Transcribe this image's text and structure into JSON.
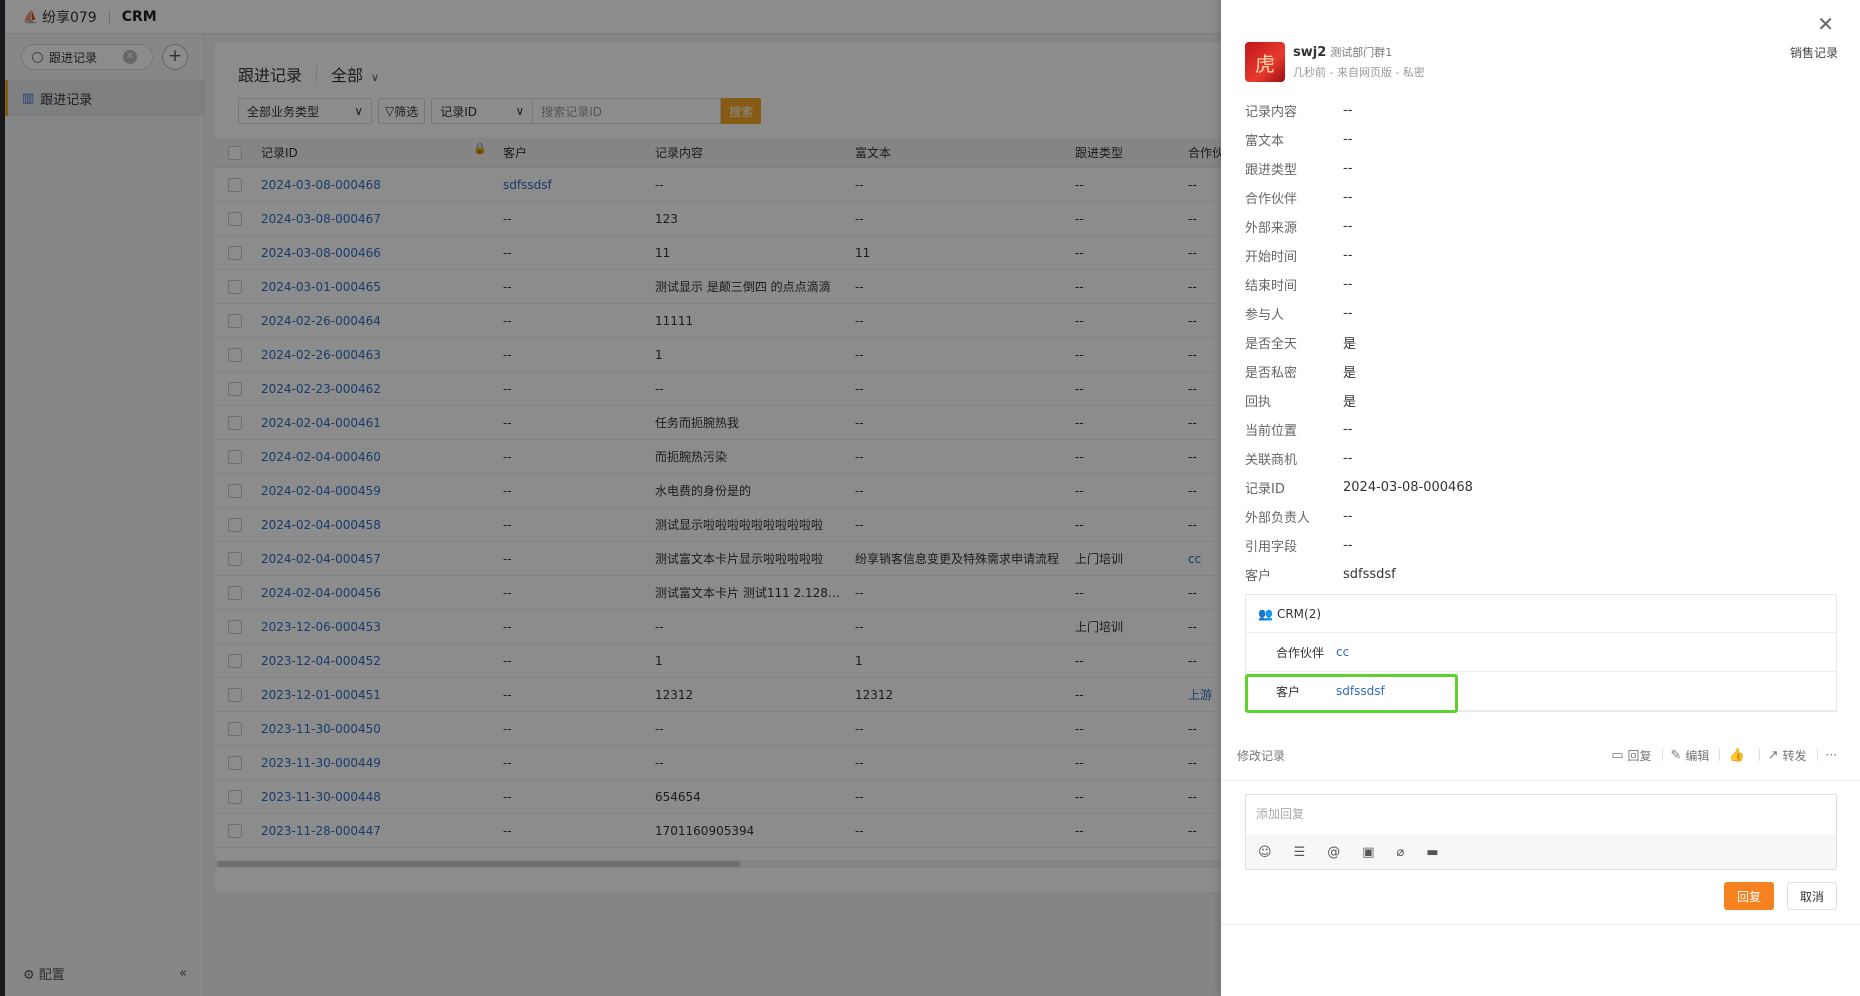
{
  "app": {
    "logo_text": "纷享079",
    "module": "CRM"
  },
  "sidebar": {
    "search_value": "跟进记录",
    "nav_item": "跟进记录",
    "footer_label": "配置",
    "collapse_glyph": "«"
  },
  "page": {
    "title": "跟进记录",
    "view": "全部",
    "business_type": "全部业务类型",
    "filter_label": "筛选",
    "search_field": "记录ID",
    "search_placeholder": "搜索记录ID",
    "search_button": "搜索"
  },
  "table": {
    "columns": [
      "记录ID",
      "客户",
      "记录内容",
      "富文本",
      "跟进类型",
      "合作伙"
    ],
    "rows": [
      {
        "id": "2024-03-08-000468",
        "customer": "sdfssdsf",
        "content": "--",
        "rich": "--",
        "type": "--",
        "partner": "--"
      },
      {
        "id": "2024-03-08-000467",
        "customer": "--",
        "content": "123",
        "rich": "--",
        "type": "--",
        "partner": "--"
      },
      {
        "id": "2024-03-08-000466",
        "customer": "--",
        "content": "11",
        "rich": "11",
        "type": "--",
        "partner": "--"
      },
      {
        "id": "2024-03-01-000465",
        "customer": "--",
        "content": "测试显示 是颠三倒四 的点点滴滴",
        "rich": "--",
        "type": "--",
        "partner": "--"
      },
      {
        "id": "2024-02-26-000464",
        "customer": "--",
        "content": "11111",
        "rich": "--",
        "type": "--",
        "partner": "--"
      },
      {
        "id": "2024-02-26-000463",
        "customer": "--",
        "content": "1",
        "rich": "--",
        "type": "--",
        "partner": "--"
      },
      {
        "id": "2024-02-23-000462",
        "customer": "--",
        "content": "--",
        "rich": "--",
        "type": "--",
        "partner": "--"
      },
      {
        "id": "2024-02-04-000461",
        "customer": "--",
        "content": "任务而扼腕热我",
        "rich": "--",
        "type": "--",
        "partner": "--"
      },
      {
        "id": "2024-02-04-000460",
        "customer": "--",
        "content": "而扼腕热污染",
        "rich": "--",
        "type": "--",
        "partner": "--"
      },
      {
        "id": "2024-02-04-000459",
        "customer": "--",
        "content": "水电费的身份是的",
        "rich": "--",
        "type": "--",
        "partner": "--"
      },
      {
        "id": "2024-02-04-000458",
        "customer": "--",
        "content": "测试显示啦啦啦啦啦啦啦啦啦啦",
        "rich": "--",
        "type": "--",
        "partner": "--"
      },
      {
        "id": "2024-02-04-000457",
        "customer": "--",
        "content": "测试富文本卡片显示啦啦啦啦啦",
        "rich": "纷享销客信息变更及特殊需求申请流程",
        "type": "上门培训",
        "partner": "cc"
      },
      {
        "id": "2024-02-04-000456",
        "customer": "--",
        "content": "测试富文本卡片 测试111 2.1280 ...",
        "rich": "--",
        "type": "--",
        "partner": "--"
      },
      {
        "id": "2023-12-06-000453",
        "customer": "--",
        "content": "--",
        "rich": "--",
        "type": "上门培训",
        "partner": "--"
      },
      {
        "id": "2023-12-04-000452",
        "customer": "--",
        "content": "1",
        "rich": "1",
        "type": "--",
        "partner": "--"
      },
      {
        "id": "2023-12-01-000451",
        "customer": "--",
        "content": "12312",
        "rich": "12312",
        "type": "--",
        "partner": "上游"
      },
      {
        "id": "2023-11-30-000450",
        "customer": "--",
        "content": "--",
        "rich": "--",
        "type": "--",
        "partner": "--"
      },
      {
        "id": "2023-11-30-000449",
        "customer": "--",
        "content": "--",
        "rich": "--",
        "type": "--",
        "partner": "--"
      },
      {
        "id": "2023-11-30-000448",
        "customer": "--",
        "content": "654654",
        "rich": "--",
        "type": "--",
        "partner": "--"
      },
      {
        "id": "2023-11-28-000447",
        "customer": "--",
        "content": "1701160905394",
        "rich": "--",
        "type": "--",
        "partner": "--"
      }
    ]
  },
  "drawer": {
    "user": "swj2",
    "dept": "测试部门群1",
    "meta": "几秒前 - 来自网页版 - 私密",
    "tag": "销售记录",
    "avatar_glyph": "虎",
    "fields": [
      {
        "label": "记录内容",
        "value": "--"
      },
      {
        "label": "富文本",
        "value": "--"
      },
      {
        "label": "跟进类型",
        "value": "--"
      },
      {
        "label": "合作伙伴",
        "value": "--"
      },
      {
        "label": "外部来源",
        "value": "--"
      },
      {
        "label": "开始时间",
        "value": "--"
      },
      {
        "label": "结束时间",
        "value": "--"
      },
      {
        "label": "参与人",
        "value": "--"
      },
      {
        "label": "是否全天",
        "value": "是"
      },
      {
        "label": "是否私密",
        "value": "是"
      },
      {
        "label": "回执",
        "value": "是"
      },
      {
        "label": "当前位置",
        "value": "--"
      },
      {
        "label": "关联商机",
        "value": "--"
      },
      {
        "label": "记录ID",
        "value": "2024-03-08-000468"
      },
      {
        "label": "外部负责人",
        "value": "--"
      },
      {
        "label": "引用字段",
        "value": "--"
      },
      {
        "label": "客户",
        "value": "sdfssdsf"
      }
    ],
    "crm": {
      "header": "CRM(2)",
      "items": [
        {
          "label": "合作伙伴",
          "value": "cc"
        },
        {
          "label": "客户",
          "value": "sdfssdsf"
        }
      ]
    },
    "actions": {
      "modify": "修改记录",
      "reply": "回复",
      "edit": "编辑",
      "forward": "转发",
      "more": "···"
    },
    "reply_placeholder": "添加回复",
    "reply_button": "回复",
    "cancel_button": "取消"
  },
  "colors": {
    "accent": "#f5811f",
    "link": "#2e6dc4",
    "highlight": "#5cd12f"
  }
}
